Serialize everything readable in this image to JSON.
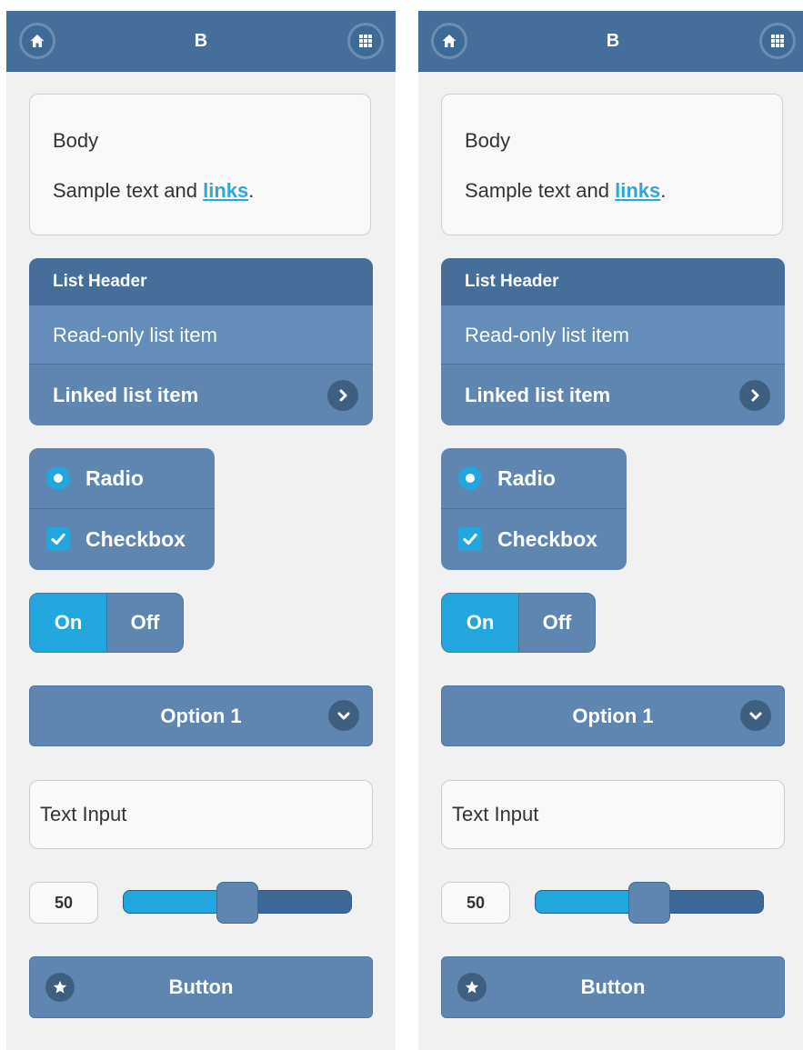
{
  "theme": {
    "header_bg": "#456f9a",
    "surface": "#5e86b0",
    "accent": "#22a6de",
    "page_bg": "#f1f1f1",
    "link": "#2ea7df"
  },
  "phones": [
    {
      "header": {
        "title": "B",
        "left_icon": "home-icon",
        "right_icon": "grid-icon"
      },
      "body_box": {
        "title": "Body",
        "text_before": "Sample text and ",
        "link_text": "links",
        "text_after": "."
      },
      "list": {
        "header": "List Header",
        "readonly_item": "Read-only list item",
        "linked_item": "Linked list item",
        "linked_icon": "chevron-right-icon"
      },
      "controls": {
        "radio_label": "Radio",
        "checkbox_label": "Checkbox"
      },
      "flip": {
        "on_label": "On",
        "off_label": "Off",
        "selected": "On"
      },
      "select": {
        "value": "Option 1",
        "icon": "chevron-down-icon"
      },
      "text_input": {
        "placeholder": "Text Input"
      },
      "slider": {
        "value": "50",
        "min": 0,
        "max": 100
      },
      "button": {
        "label": "Button",
        "icon": "star-icon"
      }
    },
    {
      "header": {
        "title": "B",
        "left_icon": "home-icon",
        "right_icon": "grid-icon"
      },
      "body_box": {
        "title": "Body",
        "text_before": "Sample text and ",
        "link_text": "links",
        "text_after": "."
      },
      "list": {
        "header": "List Header",
        "readonly_item": "Read-only list item",
        "linked_item": "Linked list item",
        "linked_icon": "chevron-right-icon"
      },
      "controls": {
        "radio_label": "Radio",
        "checkbox_label": "Checkbox"
      },
      "flip": {
        "on_label": "On",
        "off_label": "Off",
        "selected": "On"
      },
      "select": {
        "value": "Option 1",
        "icon": "chevron-down-icon"
      },
      "text_input": {
        "placeholder": "Text Input"
      },
      "slider": {
        "value": "50",
        "min": 0,
        "max": 100
      },
      "button": {
        "label": "Button",
        "icon": "star-icon"
      }
    }
  ]
}
